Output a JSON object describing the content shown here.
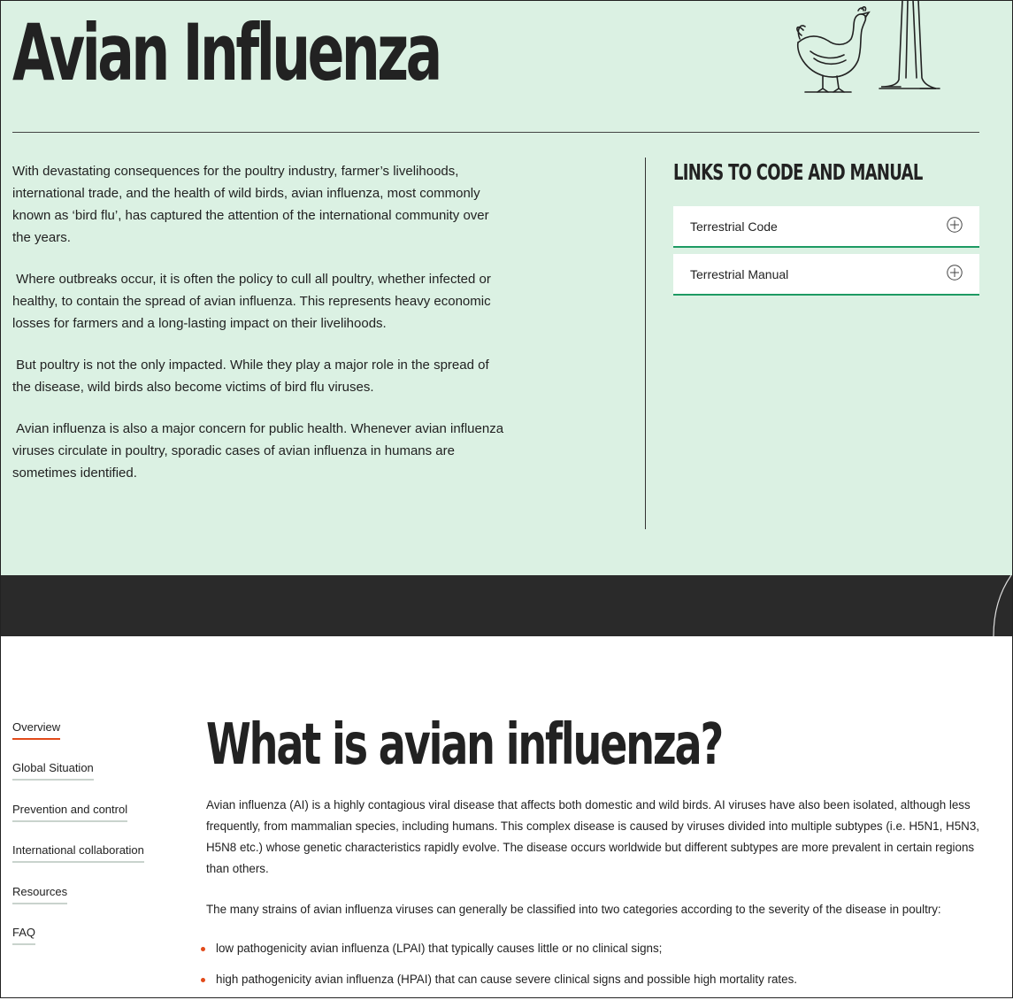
{
  "hero": {
    "title": "Avian Influenza",
    "paragraphs": [
      "With devastating consequences for the poultry industry, farmer’s livelihoods, international trade, and the health of wild birds, avian influenza, most commonly known as ‘bird flu’, has captured the attention of the international community over the years.",
      " Where outbreaks occur, it is often the policy to cull all poultry, whether infected or healthy, to contain the spread of avian influenza. This represents heavy economic losses for farmers and a long-lasting impact on their livelihoods.",
      " But poultry is not the only impacted. While they play a major role in the spread of the disease, wild birds also become victims of bird flu viruses.",
      " Avian influenza is also a major concern for public health. Whenever avian influenza viruses circulate in poultry, sporadic cases of avian influenza in humans are sometimes identified."
    ]
  },
  "links": {
    "title": "LINKS TO CODE AND MANUAL",
    "items": [
      {
        "label": "Terrestrial Code",
        "icon": "plus-circle-icon"
      },
      {
        "label": "Terrestrial Manual",
        "icon": "plus-circle-icon"
      }
    ]
  },
  "sidebar": {
    "items": [
      {
        "label": "Overview",
        "active": true
      },
      {
        "label": "Global Situation"
      },
      {
        "label": "Prevention and control"
      },
      {
        "label": "International collaboration"
      },
      {
        "label": "Resources"
      },
      {
        "label": "FAQ"
      }
    ]
  },
  "main": {
    "title": "What is avian influenza?",
    "paragraphs": [
      "Avian influenza (AI) is a highly contagious viral disease that affects both domestic and wild birds. AI viruses have also been isolated, although less frequently, from mammalian species, including humans. This complex disease is caused by viruses divided into multiple subtypes (i.e. H5N1, H5N3, H5N8 etc.) whose genetic characteristics rapidly evolve. The disease occurs worldwide but different subtypes are more prevalent in certain regions than others.",
      "The many strains of avian influenza viruses can generally be classified into two categories according to the severity of the disease in poultry:"
    ],
    "bullets": [
      "low pathogenicity avian influenza (LPAI) that typically causes little or no clinical signs;",
      "high pathogenicity avian influenza (HPAI) that can cause severe clinical signs and possible high mortality rates."
    ]
  },
  "colors": {
    "hero_bg": "#dbf1e3",
    "dark_band": "#2a2a2a",
    "accent_green": "#1d9a63",
    "accent_orange": "#e24a1a"
  }
}
